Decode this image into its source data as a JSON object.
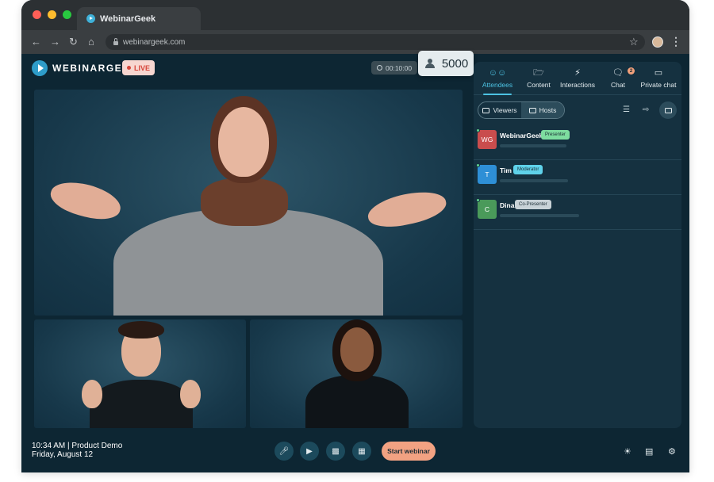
{
  "browser": {
    "tab_title": "WebinarGeek",
    "url": "webinargeek.com",
    "dots": [
      "#ff5f57",
      "#febc2e",
      "#28c840"
    ]
  },
  "app": {
    "logo_text": "WEBINARGEEK",
    "live_label": "LIVE",
    "timer": "00:10:00",
    "viewer_count": "5000"
  },
  "panel": {
    "tabs": [
      {
        "label": "Attendees",
        "icon": "attendees-icon",
        "active": true
      },
      {
        "label": "Content",
        "icon": "folder-icon"
      },
      {
        "label": "Interactions",
        "icon": "lightning-icon"
      },
      {
        "label": "Chat",
        "icon": "chat-icon",
        "badge": "2"
      },
      {
        "label": "Private chat",
        "icon": "private-chat-icon"
      }
    ],
    "segments": {
      "viewers": "Viewers",
      "hosts": "Hosts"
    },
    "hosts": [
      {
        "initials": "WG",
        "name": "WebinarGeek",
        "role": "Presenter",
        "avatar_color": "#c94d4d",
        "role_color": "#7ddc9f"
      },
      {
        "initials": "T",
        "name": "Tim",
        "role": "Moderator",
        "avatar_color": "#2e8fd6",
        "role_color": "#5fd2ea"
      },
      {
        "initials": "C",
        "name": "Dina",
        "role": "Co-Presenter",
        "avatar_color": "#4a9a5a",
        "role_color": "#c8d2d7"
      }
    ]
  },
  "footer": {
    "time_line": "10:34 AM | Product Demo",
    "date_line": "Friday, August 12",
    "start_label": "Start webinar"
  },
  "colors": {
    "accent": "#4cc3e3",
    "start_button": "#f2a282",
    "live_text": "#d6453a"
  }
}
